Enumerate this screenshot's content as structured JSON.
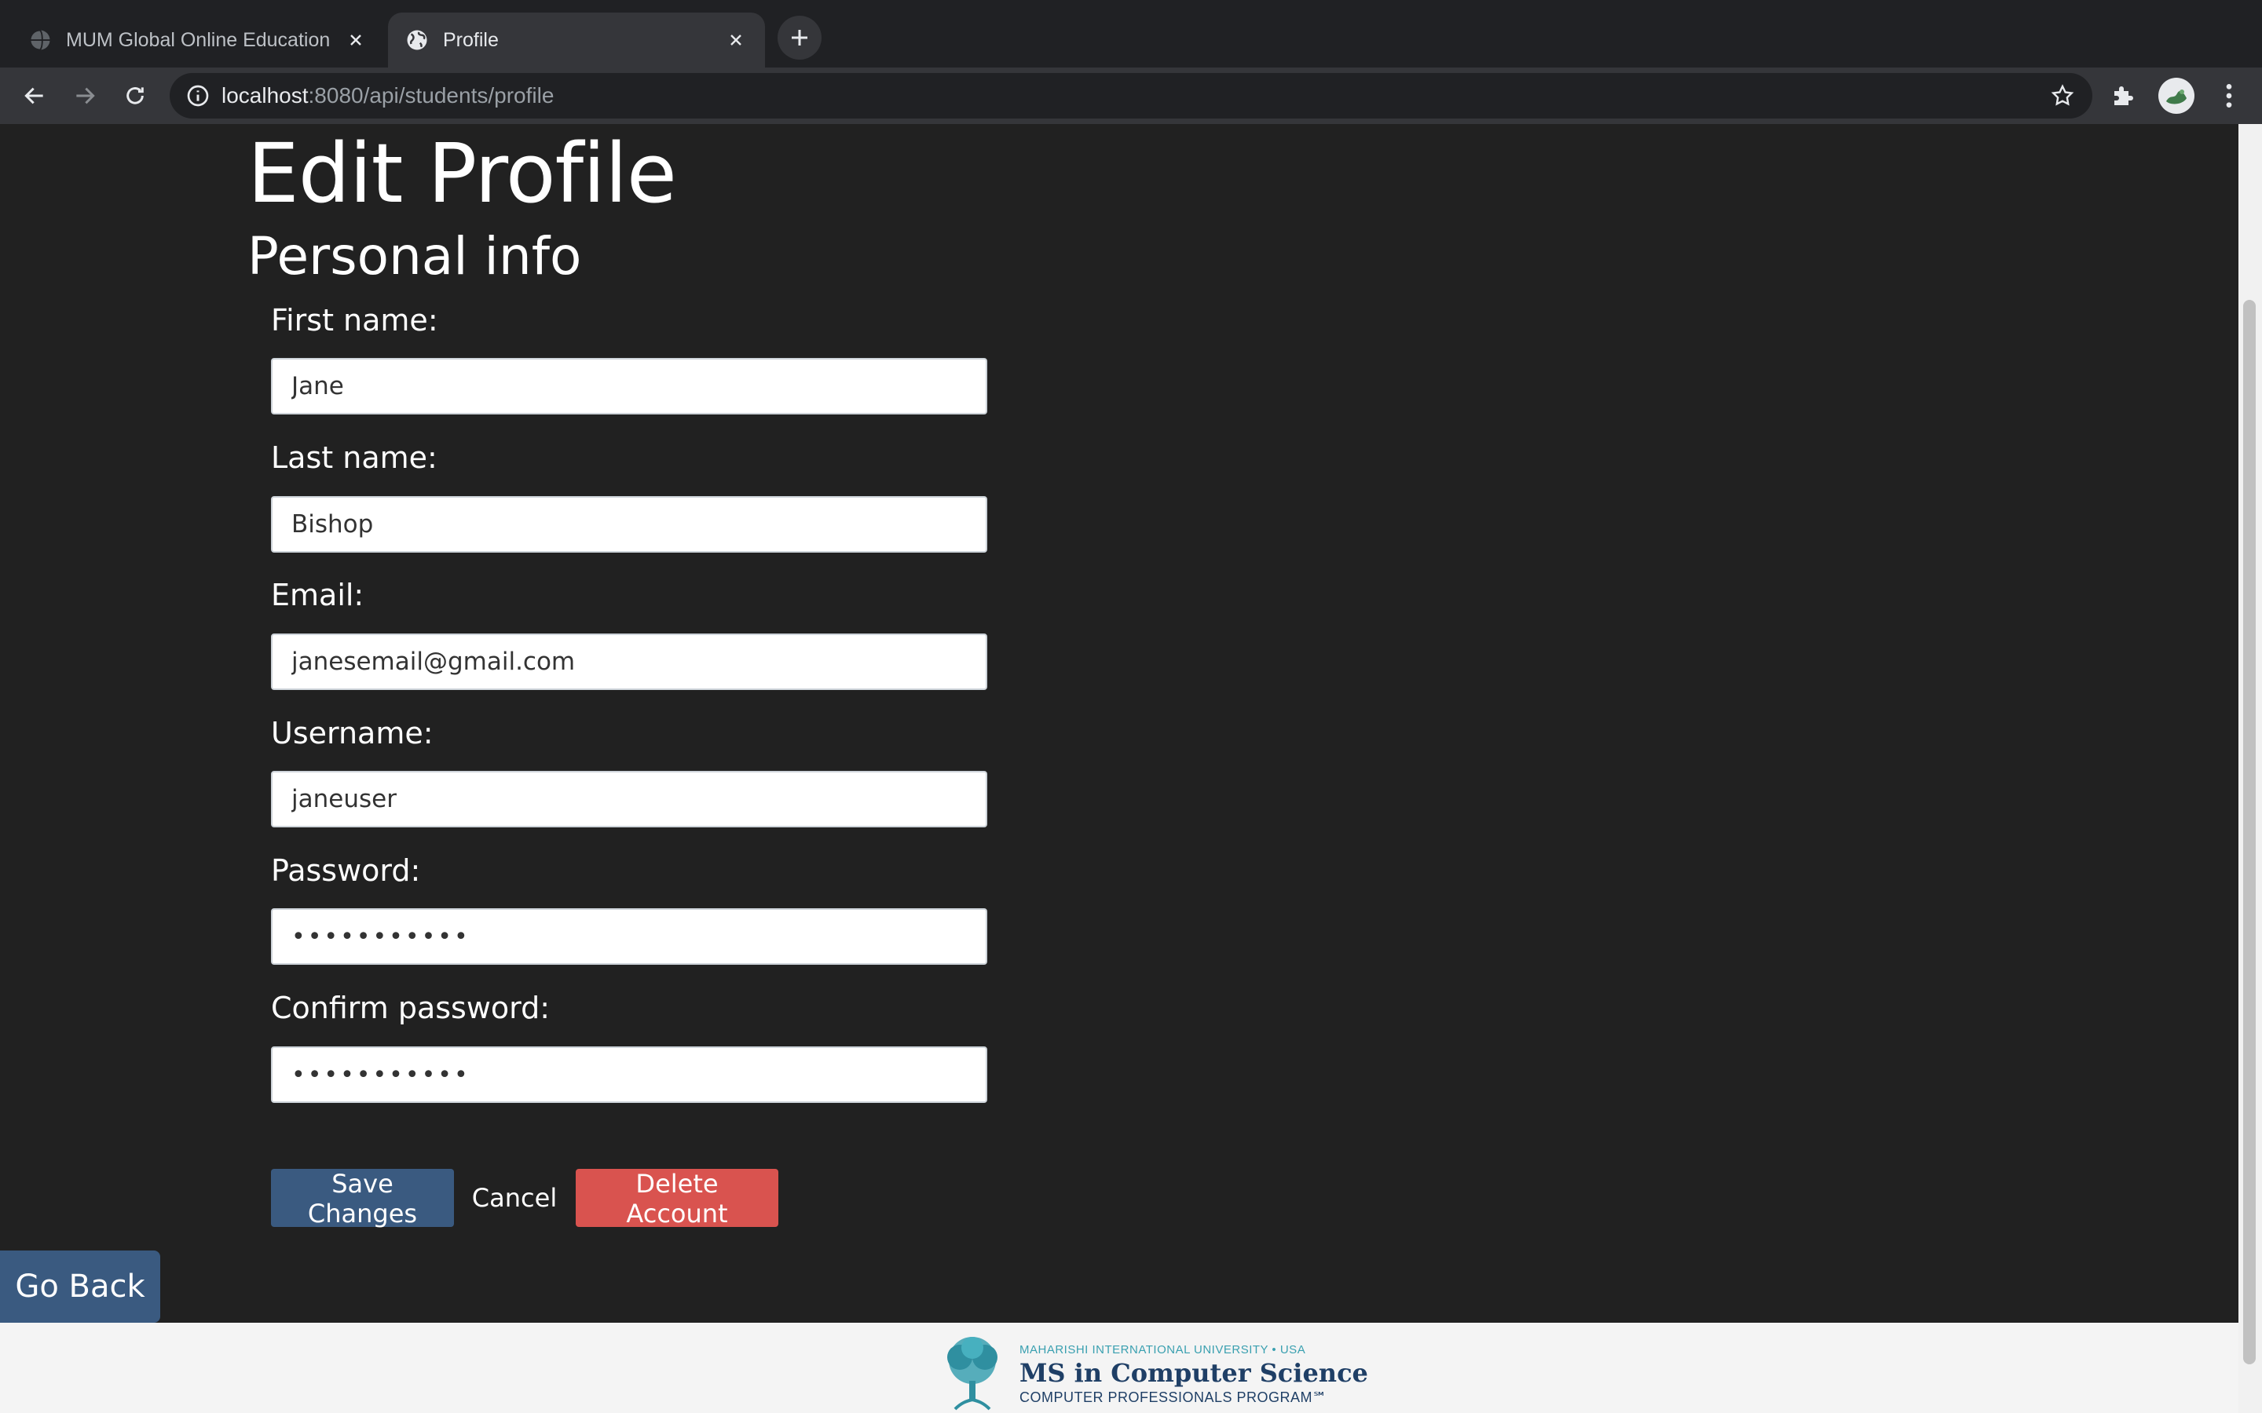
{
  "browser": {
    "tabs": [
      {
        "title": "MUM Global Online Education",
        "active": false
      },
      {
        "title": "Profile",
        "active": true
      }
    ],
    "url_host": "localhost",
    "url_path": ":8080/api/students/profile"
  },
  "page": {
    "title": "Edit Profile",
    "subtitle": "Personal info",
    "form": {
      "first_name_label": "First name:",
      "first_name_value": "Jane",
      "last_name_label": "Last name:",
      "last_name_value": "Bishop",
      "email_label": "Email:",
      "email_value": "janesemail@gmail.com",
      "username_label": "Username:",
      "username_value": "janeuser",
      "password_label": "Password:",
      "password_value": "•••••••••••",
      "confirm_password_label": "Confirm password:",
      "confirm_password_value": "•••••••••••"
    },
    "buttons": {
      "save": "Save Changes",
      "cancel": "Cancel",
      "delete": "Delete Account",
      "go_back": "Go Back"
    }
  },
  "footer": {
    "logo_line1": "MAHARISHI INTERNATIONAL UNIVERSITY • USA",
    "logo_line2": "MS in Computer Science",
    "logo_line3": "COMPUTER PROFESSIONALS PROGRAM℠"
  },
  "colors": {
    "page_bg": "#212121",
    "primary_button": "#3a5a80",
    "danger_button": "#d9534f",
    "footer_bg": "#f4f4f4"
  }
}
